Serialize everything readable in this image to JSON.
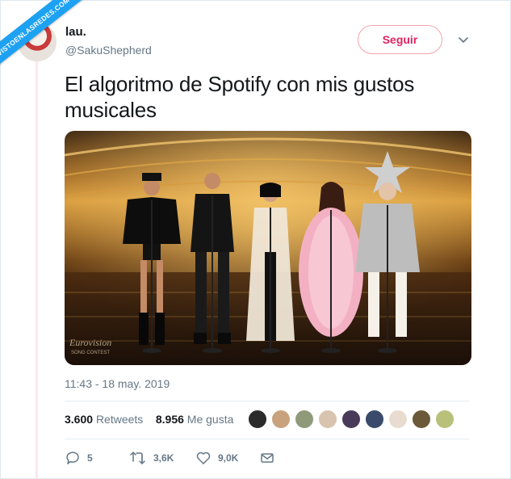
{
  "watermark": "VISTOENLASREDES.COM",
  "tweet": {
    "display_name": "lau.",
    "handle": "@SakuShepherd",
    "follow_label": "Seguir",
    "text": "El algoritmo de Spotify con mis gustos musicales",
    "media": {
      "logo_text": "Eurovision",
      "logo_sub": "SONG CONTEST"
    },
    "timestamp": "11:43 - 18 may. 2019",
    "retweets_count": "3.600",
    "retweets_label": "Retweets",
    "likes_count": "8.956",
    "likes_label": "Me gusta",
    "actions": {
      "reply": "5",
      "retweet": "3,6K",
      "like": "9,0K"
    }
  },
  "colors": {
    "accent_pink": "#e0245e",
    "follow_border": "#f4a3ad",
    "muted": "#657786",
    "watermark_blue": "#1da1f2"
  },
  "icons": [
    "chevron-down-icon",
    "reply-icon",
    "retweet-icon",
    "like-icon",
    "dm-icon"
  ]
}
